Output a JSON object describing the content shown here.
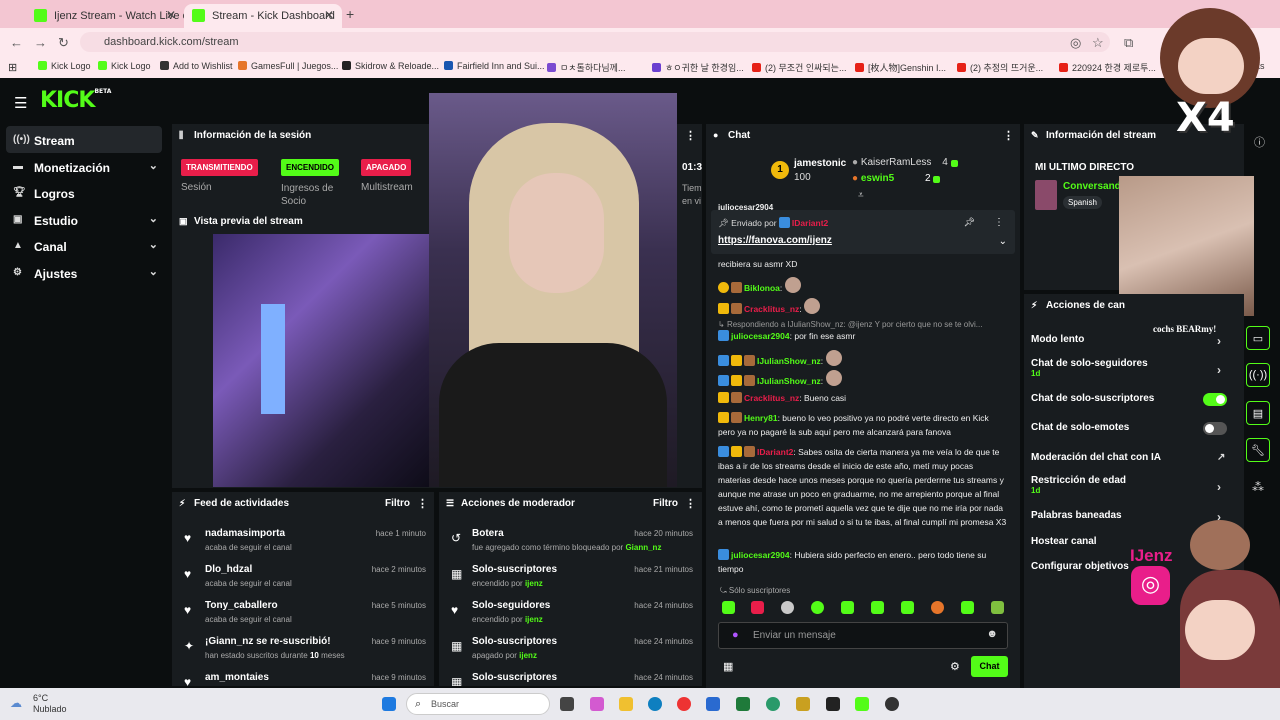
{
  "browser": {
    "tabs": [
      {
        "title": "Ijenz Stream - Watch Live on K"
      },
      {
        "title": "Stream - Kick Dashboard"
      }
    ],
    "new_tab": "+",
    "url": "dashboard.kick.com/stream",
    "bookmarks": [
      "Kick Logo",
      "Kick Logo",
      "Add to Wishlist",
      "GamesFull | Juegos...",
      "Skidrow & Reloade...",
      "Fairfield Inn and Sui...",
      "ㅁㅊ톨하다님께...",
      "ㅎㅇ귀한 날 한경임...",
      "(2) 무조건 인싸되는...",
      "[枚人物]Genshin I...",
      "(2) 추정의 뜨거운...",
      "220924 한경 제로투..."
    ],
    "bookmarks_more": "marks"
  },
  "app": {
    "logo": "KICK",
    "logo_sup": "BETA",
    "sidebar": [
      {
        "label": "Stream",
        "icon": "stream-icon"
      },
      {
        "label": "Monetización",
        "icon": "money-icon"
      },
      {
        "label": "Logros",
        "icon": "trophy-icon"
      },
      {
        "label": "Estudio",
        "icon": "studio-icon"
      },
      {
        "label": "Canal",
        "icon": "channel-icon"
      },
      {
        "label": "Ajustes",
        "icon": "settings-icon"
      }
    ],
    "session": {
      "title": "Información de la sesión",
      "badges": [
        {
          "label": "TRANSMITIENDO",
          "caption": "Sesión"
        },
        {
          "label": "ENCENDIDO",
          "caption": "Ingresos de Socio"
        },
        {
          "label": "APAGADO",
          "caption": "Multistream"
        }
      ],
      "time": "01:3",
      "time_caption": "Tiem en vi"
    },
    "preview": {
      "title": "Vista previa del stream"
    },
    "feed": {
      "title": "Feed de actividades",
      "filter": "Filtro",
      "items": [
        {
          "name": "nadamasimporta",
          "sub": "acaba de seguir el canal",
          "time": "hace 1 minuto",
          "icon": "heart-icon"
        },
        {
          "name": "Dlo_hdzal",
          "sub": "acaba de seguir el canal",
          "time": "hace 2 minutos",
          "icon": "heart-icon"
        },
        {
          "name": "Tony_caballero",
          "sub": "acaba de seguir el canal",
          "time": "hace 5 minutos",
          "icon": "heart-icon"
        },
        {
          "name": "¡Giann_nz se re-suscribió!",
          "sub_pre": "han estado suscritos durante ",
          "sub_num": "10",
          "sub_post": " meses",
          "time": "hace 9 minutos",
          "icon": "star-icon"
        },
        {
          "name": "am_montaies",
          "sub": "",
          "time": "hace 9 minutos",
          "icon": "heart-icon"
        }
      ]
    },
    "mod": {
      "title": "Acciones de moderador",
      "filter": "Filtro",
      "items": [
        {
          "name": "Botera",
          "sub_pre": "fue agregado como término bloqueado por ",
          "sub_user": "Giann_nz",
          "time": "hace 20 minutos",
          "icon": "undo-icon"
        },
        {
          "name": "Solo-suscriptores",
          "sub_pre": "encendido por ",
          "sub_user": "ijenz",
          "time": "hace 21 minutos",
          "icon": "gift-icon"
        },
        {
          "name": "Solo-seguidores",
          "sub_pre": "encendido por ",
          "sub_user": "ijenz",
          "time": "hace 24 minutos",
          "icon": "heart-icon"
        },
        {
          "name": "Solo-suscriptores",
          "sub_pre": "apagado por ",
          "sub_user": "ijenz",
          "time": "hace 24 minutos",
          "icon": "gift-icon"
        },
        {
          "name": "Solo-suscriptores",
          "sub_pre": "",
          "sub_user": "",
          "time": "hace 24 minutos",
          "icon": "gift-icon"
        }
      ]
    },
    "chat": {
      "title": "Chat",
      "leaders": {
        "rank": "1",
        "first_name": "jamestonic",
        "first_val": "100",
        "others": [
          {
            "name": "KaiserRamLess",
            "val": "4"
          },
          {
            "name": "eswin5",
            "val": "2"
          }
        ]
      },
      "peek_user": "juliocesar2904",
      "pinned": {
        "label": "Enviado por",
        "user": "IDariant2",
        "link": "https://fanova.com/ijenz"
      },
      "messages": [
        {
          "user": "",
          "text": "recibiera su asmr XD"
        },
        {
          "user": "Biklonoa",
          "text": ""
        },
        {
          "user": "Cracklitus_nz",
          "text": ""
        },
        {
          "user": "",
          "reply": "Respondiendo a IJulianShow_nz: @ijenz Y por cierto que no se te olvi..."
        },
        {
          "user": "juliocesar2904",
          "text": "por fin ese asmr"
        },
        {
          "user": "IJulianShow_nz",
          "text": ""
        },
        {
          "user": "IJulianShow_nz",
          "text": ""
        },
        {
          "user": "Cracklitus_nz",
          "text": "Bueno casi"
        },
        {
          "user": "Henry81",
          "text": "bueno lo veo positivo ya no podré verte directo en Kick pero ya no pagaré la sub aquí pero me alcanzará para fanova"
        },
        {
          "user": "IDariant2",
          "text": "Sabes osita de cierta manera ya me veía lo de que te ibas a ir de los streams desde el inicio de este año, metí muy pocas materias desde hace unos meses porque no quería perderme tus streams y aunque me atrase un poco en graduarme, no me arrepiento porque al final estuve ahí, como te prometí aquella vez que te dije que no me iría por nada a menos que fuera por mi salud o si tu te ibas, al final cumplí mi promesa X3"
        },
        {
          "user": "juliocesar2904",
          "text": "Hubiera sido perfecto en enero.. pero todo tiene su tiempo"
        }
      ],
      "mode": "Sólo suscriptores",
      "placeholder": "Enviar un mensaje",
      "send": "Chat"
    },
    "stream_info": {
      "title": "Información del stream",
      "last": "MI ULTIMO DIRECTO",
      "category": "Conversando",
      "language": "Spanish"
    },
    "actions": {
      "title": "Acciones de can",
      "items": [
        {
          "label": "Modo lento",
          "detail": "",
          "control": "arrow"
        },
        {
          "label": "Chat de solo-seguidores",
          "detail": "1d",
          "control": "arrow"
        },
        {
          "label": "Chat de solo-suscriptores",
          "detail": "",
          "control": "toggle-on"
        },
        {
          "label": "Chat de solo-emotes",
          "detail": "",
          "control": "toggle-off"
        },
        {
          "label": "Moderación del chat con IA",
          "detail": "",
          "control": "chart"
        },
        {
          "label": "Restricción de edad",
          "detail": "1d",
          "control": "arrow"
        },
        {
          "label": "Palabras baneadas",
          "detail": "",
          "control": "arrow"
        },
        {
          "label": "Hostear canal",
          "detail": "",
          "control": ""
        },
        {
          "label": "Configurar objetivos",
          "detail": "",
          "control": ""
        }
      ]
    },
    "overlay": {
      "x4": "X4",
      "brand": "IJenz",
      "sticker": "cochs BEARmy!"
    }
  },
  "taskbar": {
    "weather_temp": "6°C",
    "weather_desc": "Nublado",
    "search": "Buscar"
  },
  "colors": {
    "accent": "#53fc18",
    "live_red": "#e91e4a",
    "panel": "#181c1f",
    "bg": "#0b0e0f"
  }
}
